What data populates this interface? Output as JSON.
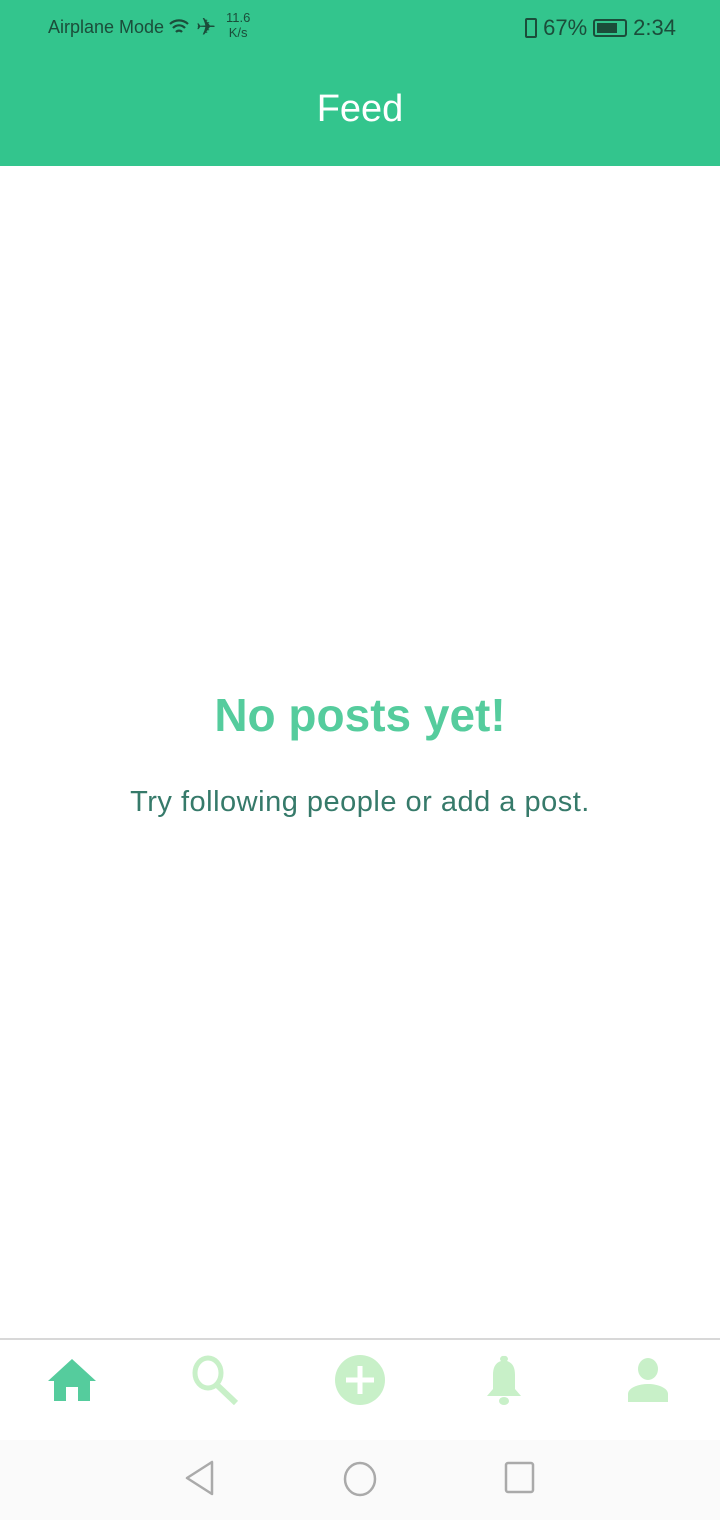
{
  "status_bar": {
    "mode": "Airplane Mode",
    "speed_value": "11.6",
    "speed_unit": "K/s",
    "battery": "67%",
    "time": "2:34"
  },
  "header": {
    "title": "Feed"
  },
  "empty_state": {
    "title": "No posts yet!",
    "subtitle": "Try following people or add a post."
  },
  "tabs": [
    {
      "name": "home",
      "active": true
    },
    {
      "name": "search"
    },
    {
      "name": "add-post"
    },
    {
      "name": "notifications"
    },
    {
      "name": "profile"
    }
  ],
  "colors": {
    "accent": "#33c58d",
    "active_icon": "#55cc9d",
    "inactive_icon": "#c8f0c8"
  }
}
